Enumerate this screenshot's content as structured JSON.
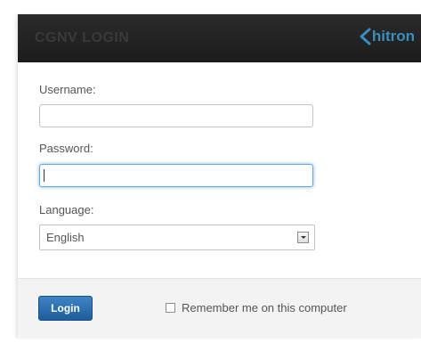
{
  "header": {
    "title": "CGNV LOGIN",
    "logo_text": "hitron",
    "logo_color": "#3b8dbd"
  },
  "form": {
    "username_label": "Username:",
    "username_value": "",
    "password_label": "Password:",
    "password_value": "",
    "language_label": "Language:",
    "language_selected": "English"
  },
  "footer": {
    "login_label": "Login",
    "remember_label": "Remember me on this computer",
    "remember_checked": false
  },
  "colors": {
    "header_bg": "#1f1f1f",
    "button_blue": "#2a6fb0",
    "focus_border": "#66a9e0"
  },
  "icons": {
    "logo_mark": "hitron-swoosh-icon",
    "select_arrow": "chevron-down-icon",
    "checkbox": "checkbox-unchecked-icon"
  }
}
